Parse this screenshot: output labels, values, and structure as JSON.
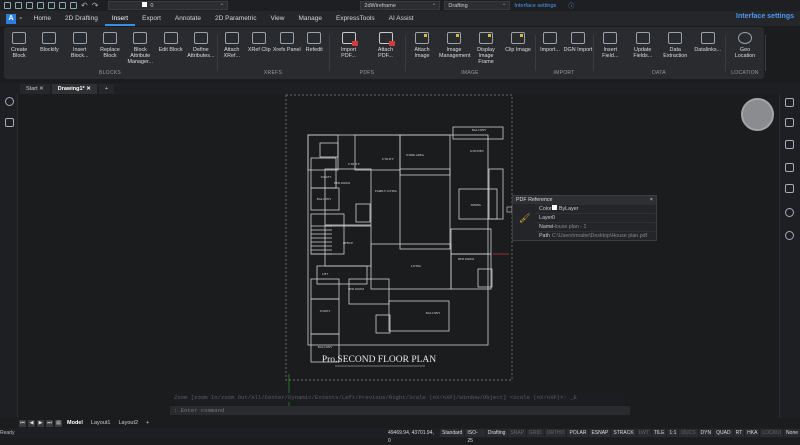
{
  "quick_access": {
    "layer_value": "0",
    "visual_style": "2dWireframe",
    "workspace": "Drafting",
    "interface_settings": "Interface settings"
  },
  "menu": {
    "tabs": [
      "Home",
      "2D Drafting",
      "Insert",
      "Export",
      "Annotate",
      "2D Parametric",
      "View",
      "Manage",
      "ExpressTools",
      "AI Assist"
    ],
    "active": "Insert",
    "interface_settings": "Interface settings"
  },
  "ribbon": {
    "blocks": {
      "label": "BLOCKS",
      "buttons": [
        "Create Block",
        "Blockify",
        "Insert Block...",
        "Replace Block",
        "Block Attribute Manager...",
        "Edit Block",
        "Define Attributes..."
      ]
    },
    "xrefs": {
      "label": "XREFS",
      "buttons": [
        "Attach XRef...",
        "XRef Clip",
        "Xrefs Panel",
        "Refedit"
      ]
    },
    "pdfs": {
      "label": "PDFS",
      "buttons": [
        "Import PDF...",
        "Attach PDF..."
      ]
    },
    "image": {
      "label": "IMAGE",
      "buttons": [
        "Attach Image",
        "Image Management",
        "Display Image Frame",
        "Clip Image"
      ]
    },
    "import": {
      "label": "IMPORT",
      "buttons": [
        "Import...",
        "DGN Import"
      ],
      "dgn_glyph": "DGN"
    },
    "data": {
      "label": "DATA",
      "buttons": [
        "Insert Field...",
        "Update Fields...",
        "Data Extraction",
        "Datalinks..."
      ]
    },
    "location": {
      "label": "LOCATION",
      "buttons": [
        "Geo Location"
      ]
    }
  },
  "doc_tabs": [
    "Start",
    "Drawing1*"
  ],
  "drawing": {
    "title": "Pro.SECOND  FLOOR PLAN",
    "rooms": [
      "BALCONY",
      "KITCHEN",
      "UTILITY",
      "UTILITY",
      "WORK AREA",
      "TOILET",
      "BED ROOM",
      "FAMILY LIVING",
      "BALCONY",
      "DINING",
      "OFFICE",
      "LIVING",
      "LIFT",
      "BED ROOM",
      "BED ROOM",
      "TOILET",
      "BALCONY",
      "BALCONY"
    ]
  },
  "pdf_reference": {
    "title": "PDF Reference",
    "color_label": "Color",
    "color": "ByLayer",
    "layer_label": "Layer",
    "layer": "0",
    "name_label": "Name",
    "name": "House plan - 1",
    "path_label": "Path",
    "path": "C:\\Users\\mrabe\\Desktop\\House plan.pdf"
  },
  "command": {
    "history": "Zoom [zoom In/zoom Out/All/Center/Dynamic/Extents/Left/Previous/Right/Scale (nX/nXP)/Window/Object] <Scale (nX/nXP)>: _E",
    "placeholder": ": Enter command"
  },
  "layout_tabs": [
    "Model",
    "Layout1",
    "Layout2"
  ],
  "status": {
    "ready": "Ready",
    "coords": "49469.94, 43701.94, 0",
    "toggles": [
      {
        "t": "Standard",
        "on": true
      },
      {
        "t": "ISO-25",
        "on": true
      },
      {
        "t": "Drafting",
        "on": true
      },
      {
        "t": "SNAP",
        "on": false
      },
      {
        "t": "GRID",
        "on": false
      },
      {
        "t": "ORTHO",
        "on": false
      },
      {
        "t": "POLAR",
        "on": true
      },
      {
        "t": "ESNAP",
        "on": true
      },
      {
        "t": "STRACK",
        "on": true
      },
      {
        "t": "LWT",
        "on": false
      },
      {
        "t": "TILE",
        "on": true
      },
      {
        "t": "1:1",
        "on": true
      },
      {
        "t": "DUCS",
        "on": false
      },
      {
        "t": "DYN",
        "on": true
      },
      {
        "t": "QUAD",
        "on": true
      },
      {
        "t": "RT",
        "on": true
      },
      {
        "t": "HKA",
        "on": true
      },
      {
        "t": "LOCKUI",
        "on": false
      },
      {
        "t": "None",
        "on": true
      }
    ]
  }
}
